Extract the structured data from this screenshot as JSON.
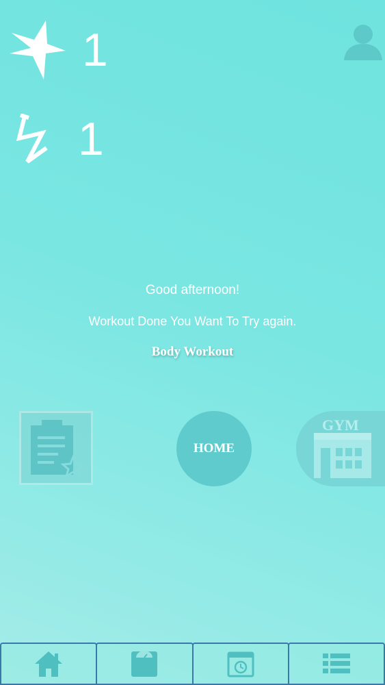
{
  "header": {
    "stars": {
      "icon": "star-icon",
      "value": "1"
    },
    "energy": {
      "icon": "lightning-icon",
      "value": "1"
    },
    "profile_icon": "user-icon"
  },
  "main": {
    "greeting": "Good afternoon!",
    "status_message": "Workout Done You Want To Try again.",
    "workout_name": "Body Workout"
  },
  "nav_buttons": {
    "left_icon": "clipboard-star-icon",
    "home_label": "HOME",
    "gym_label": "GYM"
  },
  "tabbar": {
    "tabs": [
      {
        "icon": "home-icon"
      },
      {
        "icon": "scale-icon"
      },
      {
        "icon": "calendar-clock-icon"
      },
      {
        "icon": "list-icon"
      }
    ]
  },
  "colors": {
    "background": "#7ae6e2",
    "home_button": "#5fcbcc",
    "tab_border": "#3b78a8",
    "icon_dark": "#4fbfc0"
  }
}
